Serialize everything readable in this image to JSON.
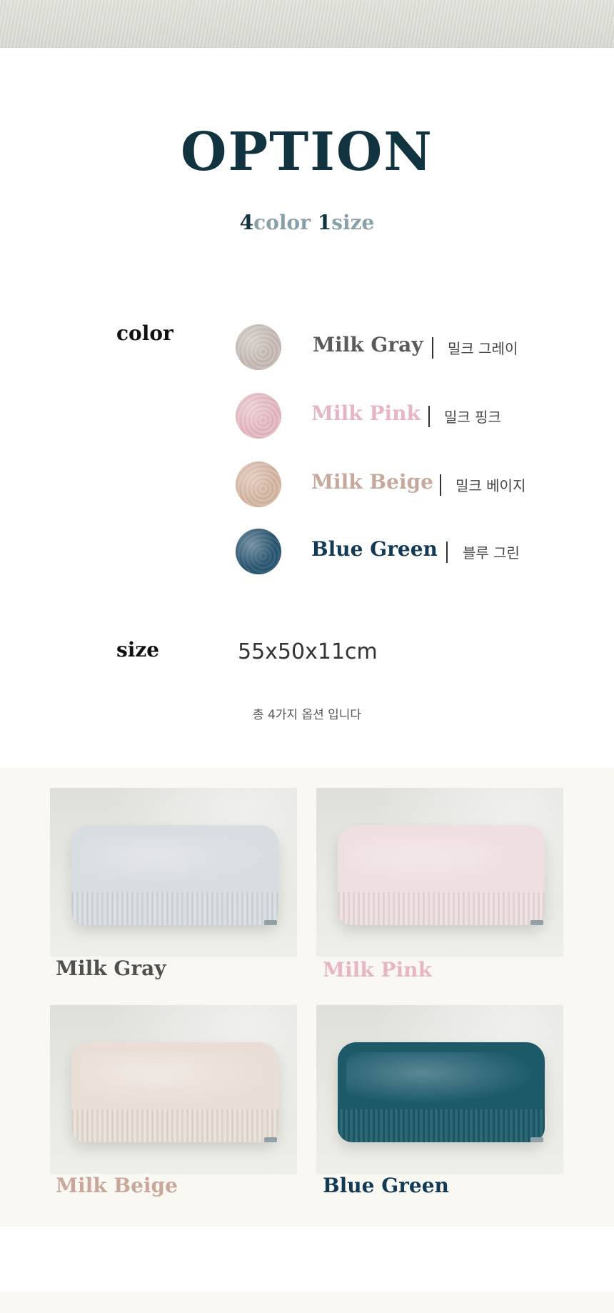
{
  "header": {
    "title": "OPTION"
  },
  "subtitle": {
    "num1": "4",
    "word1": "color",
    "num2": "1",
    "word2": "size"
  },
  "colors_section": {
    "label": "color",
    "items": [
      {
        "name": "Milk Gray",
        "korean": "밀크 그레이",
        "color": "#5b5b5b",
        "swatch": "#c9beb7"
      },
      {
        "name": "Milk Pink",
        "korean": "밀크 핑크",
        "color": "#e8b5c5",
        "swatch": "#e7bcc3"
      },
      {
        "name": "Milk Beige",
        "korean": "밀크 베이지",
        "color": "#c6a99c",
        "swatch": "#d9b9a6"
      },
      {
        "name": "Blue Green",
        "korean": "블루 그린",
        "color": "#123a56",
        "swatch": "#2d5974"
      }
    ]
  },
  "size_section": {
    "label": "size",
    "value": "55x50x11cm"
  },
  "note": "총 4가지 옵션 입니다",
  "gallery": {
    "items": [
      {
        "caption": "Milk Gray",
        "caption_color": "#4f4f4f",
        "fabric": "#d8dde2"
      },
      {
        "caption": "Milk Pink",
        "caption_color": "#e8b5c5",
        "fabric": "#eedfe0"
      },
      {
        "caption": "Milk Beige",
        "caption_color": "#c9a79b",
        "fabric": "#e9dfd7"
      },
      {
        "caption": "Blue Green",
        "caption_color": "#123a56",
        "fabric": "#1c5a6a"
      }
    ]
  }
}
